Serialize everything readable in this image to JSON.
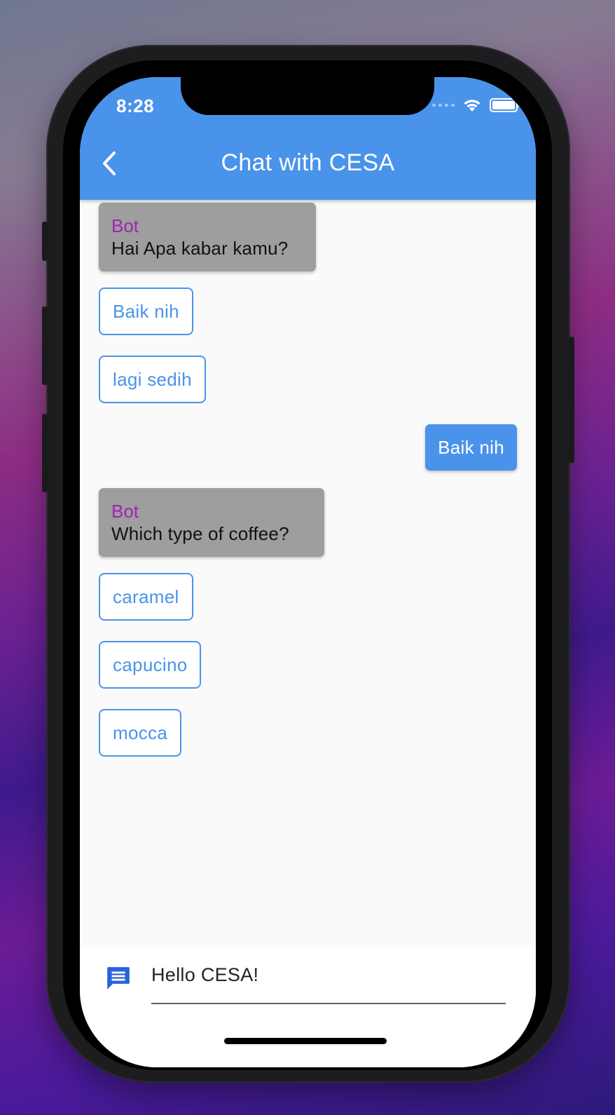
{
  "status_bar": {
    "time": "8:28"
  },
  "app_bar": {
    "title": "Chat with CESA"
  },
  "messages": [
    {
      "type": "bot",
      "sender": "Bot",
      "text": "Hai Apa kabar kamu?"
    },
    {
      "type": "option",
      "text": "Baik nih"
    },
    {
      "type": "option",
      "text": "lagi sedih"
    },
    {
      "type": "user",
      "text": "Baik nih"
    },
    {
      "type": "bot",
      "sender": "Bot",
      "text": "Which type of coffee?"
    },
    {
      "type": "option",
      "text": "caramel"
    },
    {
      "type": "option",
      "text": "capucino"
    },
    {
      "type": "option",
      "text": "mocca"
    }
  ],
  "input": {
    "value": "Hello CESA!"
  },
  "colors": {
    "primary": "#4a93ea",
    "bot_bubble": "#9e9e9e",
    "bot_name": "#9c27b0",
    "input_icon": "#2962d9"
  },
  "icons": {
    "back": "chevron-left-icon",
    "wifi": "wifi-icon",
    "battery": "battery-icon",
    "message": "message-icon"
  }
}
